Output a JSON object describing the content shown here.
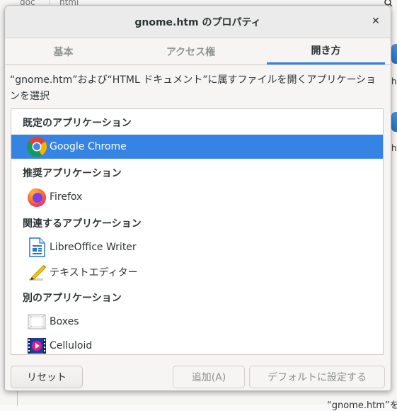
{
  "background": {
    "tabs": [
      "doc",
      "html"
    ],
    "file_labels": [
      "h",
      "ht"
    ],
    "bottom_label": "“gnome.htm”を"
  },
  "dialog": {
    "title": "gnome.htm のプロパティ",
    "close_glyph": "✕",
    "tabs": [
      {
        "label": "基本",
        "active": false
      },
      {
        "label": "アクセス権",
        "active": false
      },
      {
        "label": "開き方",
        "active": true
      }
    ],
    "description": "“gnome.htm”および“HTML ドキュメント”に属すファイルを開くアプリケーションを選択",
    "sections": {
      "default": "既定のアプリケーション",
      "recommended": "推奨アプリケーション",
      "related": "関連するアプリケーション",
      "other": "別のアプリケーション"
    },
    "apps": {
      "chrome": "Google Chrome",
      "firefox": "Firefox",
      "writer": "LibreOffice Writer",
      "text_editor": "テキストエディター",
      "boxes": "Boxes",
      "celluloid": "Celluloid"
    },
    "buttons": {
      "reset": "リセット",
      "add": "追加(A)",
      "set_default": "デフォルトに設定する"
    }
  },
  "colors": {
    "accent": "#3584e4",
    "selected_text": "#ffffff",
    "text": "#2e3436",
    "disabled_text": "#8b8e8f"
  }
}
